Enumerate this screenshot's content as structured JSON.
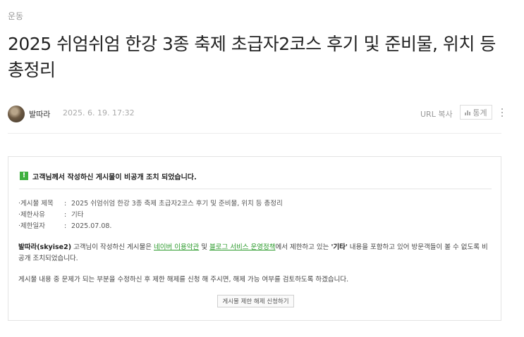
{
  "post": {
    "category": "운동",
    "title": "2025 쉬엄쉬엄 한강 3종 축제 초급자2코스 후기 및 준비물, 위치 등 총정리",
    "author": "발따라",
    "date": "2025. 6. 19. 17:32",
    "url_copy": "URL 복사",
    "stats": "통계"
  },
  "notice": {
    "heading": "고객님께서 작성하신 게시물이 비공개 조치 되었습니다.",
    "rows": [
      {
        "key": "게시물 제목",
        "value": "2025 쉬엄쉬엄 한강 3종 축제 초급자2코스 후기 및 준비물, 위치 등 총정리"
      },
      {
        "key": "제한사유",
        "value": "기타"
      },
      {
        "key": "제한일자",
        "value": "2025.07.08."
      }
    ],
    "para1": {
      "user": "발따라(skyise2)",
      "t1": " 고객님이 작성하신 게시물은 ",
      "link1": "네이버 이용약관",
      "t2": " 및 ",
      "link2": "블로그 서비스 운영정책",
      "t3": "에서 제한하고 있는 ",
      "reason": "'기타'",
      "t4": " 내용을 포함하고 있어 방문객들이 볼 수 없도록 비공개 조치되었습니다."
    },
    "para2": "게시물 내용 중 문제가 되는 부분을 수정하신 후 제한 해제를 신청 해 주시면, 해제 가능 여부를 검토하도록 하겠습니다.",
    "button": "게시물 제한 해제 신청하기"
  },
  "colors": {
    "accent_green": "#3fb03f",
    "link_green": "#2a9a2a"
  },
  "icons": [
    "warning-icon",
    "stats-icon",
    "more-vertical-icon"
  ]
}
